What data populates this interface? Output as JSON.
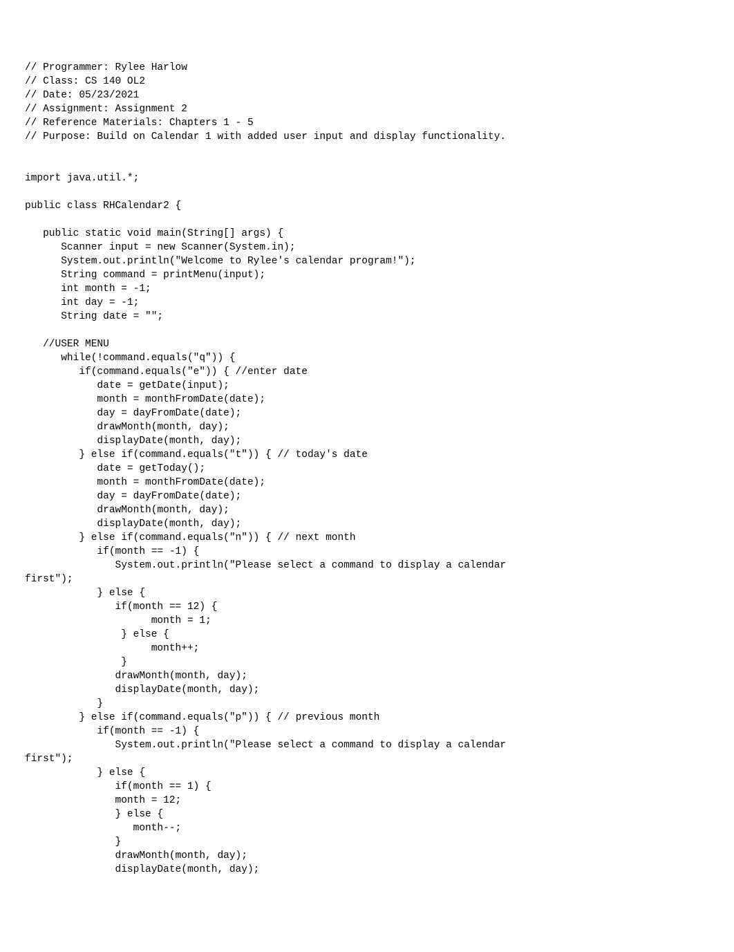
{
  "code": {
    "l1": "// Programmer: Rylee Harlow",
    "l2": "// Class: CS 140 OL2",
    "l3": "// Date: 05/23/2021",
    "l4": "// Assignment: Assignment 2",
    "l5": "// Reference Materials: Chapters 1 - 5",
    "l6": "// Purpose: Build on Calendar 1 with added user input and display functionality.",
    "l7": "",
    "l8": "",
    "l9": "import java.util.*;",
    "l10": "",
    "l11": "public class RHCalendar2 {",
    "l12": "",
    "l13": "   public static void main(String[] args) {",
    "l14": "      Scanner input = new Scanner(System.in);",
    "l15": "      System.out.println(\"Welcome to Rylee's calendar program!\");",
    "l16": "      String command = printMenu(input);",
    "l17": "      int month = -1;",
    "l18": "      int day = -1;",
    "l19": "      String date = \"\";",
    "l20": "",
    "l21": "   //USER MENU",
    "l22": "      while(!command.equals(\"q\")) {",
    "l23": "         if(command.equals(\"e\")) { //enter date",
    "l24": "            date = getDate(input);",
    "l25": "            month = monthFromDate(date);",
    "l26": "            day = dayFromDate(date);",
    "l27": "            drawMonth(month, day);",
    "l28": "            displayDate(month, day);",
    "l29": "         } else if(command.equals(\"t\")) { // today's date",
    "l30": "            date = getToday();",
    "l31": "            month = monthFromDate(date);",
    "l32": "            day = dayFromDate(date);",
    "l33": "            drawMonth(month, day);",
    "l34": "            displayDate(month, day);",
    "l35": "         } else if(command.equals(\"n\")) { // next month",
    "l36": "            if(month == -1) {",
    "l37": "               System.out.println(\"Please select a command to display a calendar",
    "l38": "first\");",
    "l39": "            } else {",
    "l40": "               if(month == 12) {",
    "l41": "                     month = 1;",
    "l42": "                } else {",
    "l43": "                     month++;",
    "l44": "                }",
    "l45": "               drawMonth(month, day);",
    "l46": "               displayDate(month, day);",
    "l47": "            }",
    "l48": "         } else if(command.equals(\"p\")) { // previous month",
    "l49": "            if(month == -1) {",
    "l50": "               System.out.println(\"Please select a command to display a calendar",
    "l51": "first\");",
    "l52": "            } else {",
    "l53": "               if(month == 1) {",
    "l54": "               month = 12;",
    "l55": "               } else {",
    "l56": "                  month--;",
    "l57": "               }",
    "l58": "               drawMonth(month, day);",
    "l59": "               displayDate(month, day);"
  }
}
